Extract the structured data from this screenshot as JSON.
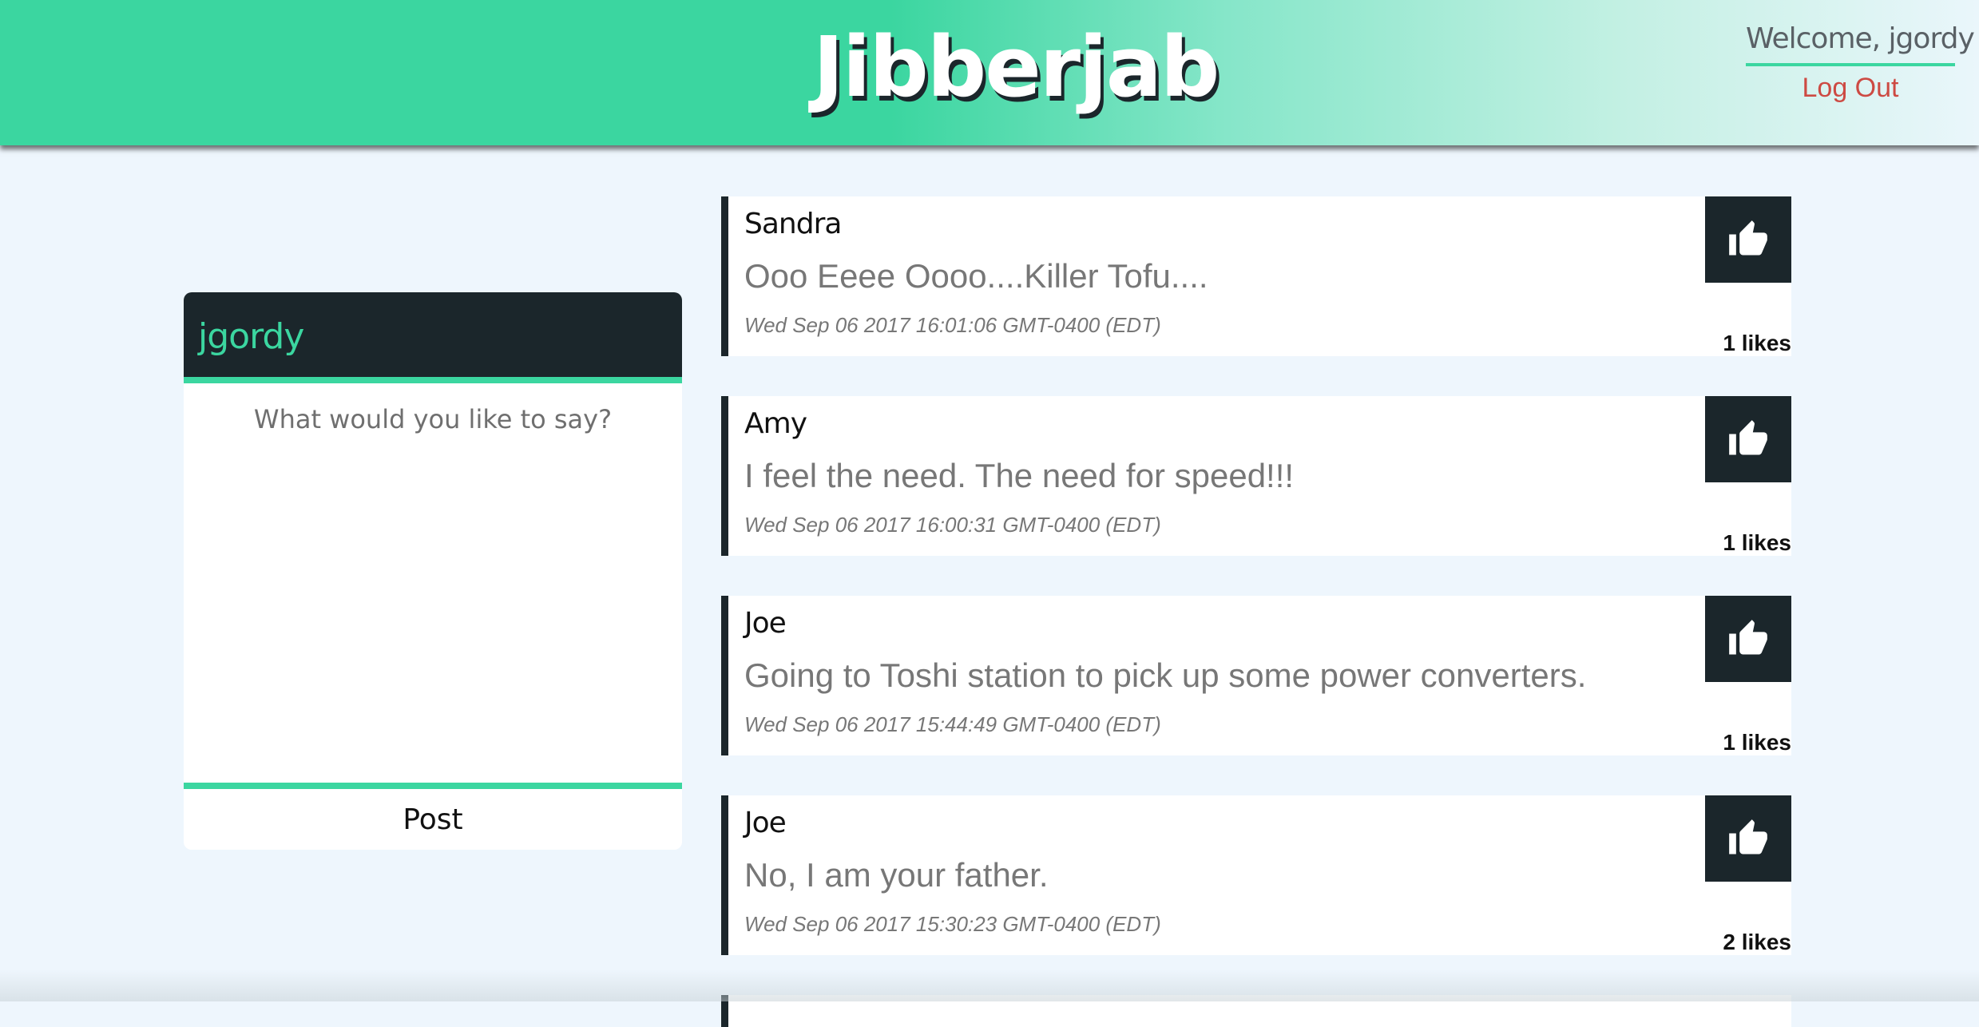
{
  "header": {
    "brand": "Jibberjab",
    "welcome": "Welcome, jgordy",
    "logout_label": "Log Out"
  },
  "compose": {
    "username": "jgordy",
    "placeholder": "What would you like to say?",
    "post_label": "Post"
  },
  "feed": {
    "posts": [
      {
        "author": "Sandra",
        "body": "Ooo Eeee Oooo....Killer Tofu....",
        "date": "Wed Sep 06 2017 16:01:06 GMT-0400 (EDT)",
        "likes": "1 likes"
      },
      {
        "author": "Amy",
        "body": "I feel the need. The need for speed!!!",
        "date": "Wed Sep 06 2017 16:00:31 GMT-0400 (EDT)",
        "likes": "1 likes"
      },
      {
        "author": "Joe",
        "body": "Going to Toshi station to pick up some power converters.",
        "date": "Wed Sep 06 2017 15:44:49 GMT-0400 (EDT)",
        "likes": "1 likes"
      },
      {
        "author": "Joe",
        "body": "No, I am your father.",
        "date": "Wed Sep 06 2017 15:30:23 GMT-0400 (EDT)",
        "likes": "2 likes"
      }
    ],
    "like_icon": "thumbs-up-icon"
  },
  "colors": {
    "accent": "#3bd6a0",
    "dark": "#1b262b",
    "logout": "#cd4a43",
    "background": "#eef6fd"
  }
}
